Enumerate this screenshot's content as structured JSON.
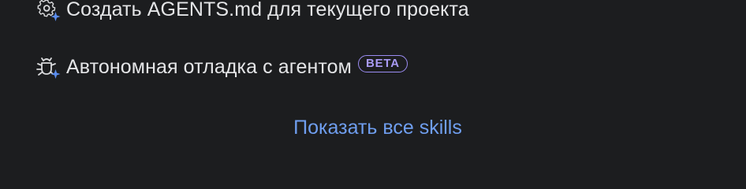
{
  "skills": {
    "items": [
      {
        "label": "Создать AGENTS.md для текущего проекта",
        "icon": "gear-sparkle-icon"
      },
      {
        "label": "Автономная отладка с агентом",
        "icon": "bug-sparkle-icon",
        "badge": "BETA"
      }
    ],
    "show_all_label": "Показать все skills"
  },
  "colors": {
    "background": "#1c1d1f",
    "text": "#e4e5e7",
    "link": "#6f9eef",
    "badge": "#9b8cf2",
    "sparkle": "#5b8def"
  }
}
